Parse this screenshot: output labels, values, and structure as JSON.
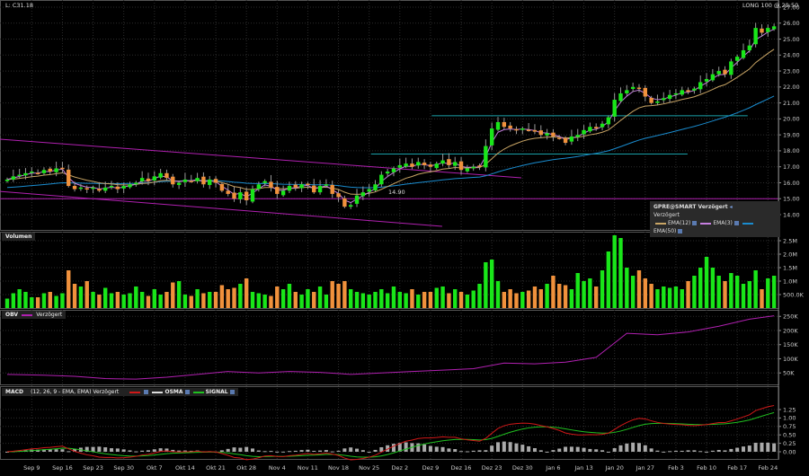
{
  "header": {
    "last_label": "L: C31.18",
    "session_label": "LONG 100 @ 29:50"
  },
  "price_legend": {
    "title": "GPRE@SMART Verzögert",
    "subtitle": "Verzögert",
    "ema12": "EMA(12)",
    "ema3": "EMA(3)",
    "ema50": "EMA(50)"
  },
  "volume_panel": {
    "title": "Volumen"
  },
  "obv_panel": {
    "title": "OBV",
    "delay": "Verzögert"
  },
  "macd_panel": {
    "title": "MACD",
    "params": "(12, 26, 9 - EMA, EMA) Verzögert",
    "osma": "OSMA",
    "signal": "SIGNAL"
  },
  "colors": {
    "up": "#19e619",
    "down": "#f0913c",
    "ema3": "#c77fe0",
    "ema12": "#c9a565",
    "ema50": "#1a8ccf",
    "trend": "#b020b0",
    "level": "#1aa0a8",
    "macd": "#d01818",
    "signal": "#20c020",
    "obv": "#b020b0"
  },
  "chart_data": {
    "type": "candlestick",
    "price_axis": {
      "ticks": [
        "27.00",
        "26.00",
        "25.00",
        "24.00",
        "23.00",
        "22.00",
        "21.00",
        "20.00",
        "19.00",
        "18.00",
        "17.00",
        "16.00",
        "15.00",
        "14.00"
      ],
      "range": [
        13.7,
        27.2
      ]
    },
    "volume_axis": {
      "ticks": [
        "2.5M",
        "2.0M",
        "1.5M",
        "1.0M",
        "500.0K"
      ]
    },
    "obv_axis": {
      "ticks": [
        "250K",
        "200K",
        "150K",
        "100K",
        "50K"
      ]
    },
    "macd_axis": {
      "ticks": [
        "1.25",
        "1.00",
        "0.75",
        "0.50",
        "0.25",
        "0.00"
      ]
    },
    "x_labels": [
      {
        "label": "Sep 9",
        "i": 4
      },
      {
        "label": "Sep 16",
        "i": 9
      },
      {
        "label": "Sep 23",
        "i": 14
      },
      {
        "label": "Sep 30",
        "i": 19
      },
      {
        "label": "Okt 7",
        "i": 24
      },
      {
        "label": "Okt 14",
        "i": 29
      },
      {
        "label": "Okt 21",
        "i": 34
      },
      {
        "label": "Okt 28",
        "i": 39
      },
      {
        "label": "Nov 4",
        "i": 44
      },
      {
        "label": "Nov 11",
        "i": 49
      },
      {
        "label": "Nov 18",
        "i": 54
      },
      {
        "label": "Nov 25",
        "i": 59
      },
      {
        "label": "Dez 2",
        "i": 64
      },
      {
        "label": "Dez 9",
        "i": 69
      },
      {
        "label": "Dez 16",
        "i": 74
      },
      {
        "label": "Dez 23",
        "i": 79
      },
      {
        "label": "Dez 30",
        "i": 84
      },
      {
        "label": "Jan 6",
        "i": 89
      },
      {
        "label": "Jan 13",
        "i": 94
      },
      {
        "label": "Jan 20",
        "i": 99
      },
      {
        "label": "Jan 27",
        "i": 104
      },
      {
        "label": "Feb 3",
        "i": 109
      },
      {
        "label": "Feb 10",
        "i": 114
      },
      {
        "label": "Feb 17",
        "i": 119
      },
      {
        "label": "Feb 24",
        "i": 124
      }
    ],
    "close": [
      16.2,
      16.4,
      16.5,
      16.6,
      16.7,
      16.6,
      16.8,
      16.7,
      16.9,
      16.9,
      15.8,
      15.6,
      15.7,
      15.6,
      15.7,
      15.5,
      15.7,
      15.8,
      15.6,
      15.8,
      15.9,
      16.0,
      16.3,
      16.1,
      16.4,
      16.6,
      16.3,
      15.9,
      16.0,
      16.2,
      16.1,
      16.3,
      15.9,
      16.2,
      16.0,
      15.5,
      15.3,
      15.0,
      15.4,
      14.9,
      15.6,
      15.9,
      16.1,
      15.7,
      15.3,
      15.5,
      15.8,
      15.7,
      15.9,
      15.9,
      15.4,
      15.8,
      15.9,
      15.3,
      15.1,
      14.5,
      14.6,
      15.2,
      15.4,
      15.6,
      15.9,
      16.5,
      16.7,
      16.9,
      17.1,
      17.2,
      17.0,
      17.3,
      17.1,
      17.0,
      17.2,
      17.4,
      17.1,
      17.3,
      16.8,
      16.9,
      17.0,
      17.0,
      18.3,
      19.4,
      19.8,
      19.5,
      19.4,
      19.3,
      19.4,
      19.3,
      19.2,
      19.0,
      19.1,
      18.9,
      18.8,
      18.5,
      18.9,
      19.0,
      19.3,
      19.5,
      19.4,
      19.7,
      20.1,
      21.2,
      21.6,
      21.8,
      22.0,
      21.9,
      21.4,
      21.0,
      21.1,
      21.3,
      21.5,
      21.6,
      21.8,
      21.7,
      21.9,
      22.3,
      22.5,
      22.8,
      23.0,
      22.8,
      23.6,
      23.9,
      24.3,
      24.6,
      25.7,
      25.4,
      25.7,
      25.8
    ],
    "volume_millions": [
      0.35,
      0.55,
      0.7,
      0.6,
      0.4,
      0.4,
      0.55,
      0.6,
      0.45,
      0.55,
      1.4,
      0.9,
      0.8,
      1.0,
      0.6,
      0.5,
      0.75,
      0.55,
      0.6,
      0.5,
      0.55,
      0.8,
      0.6,
      0.45,
      0.7,
      0.5,
      0.6,
      0.95,
      1.0,
      0.5,
      0.45,
      0.7,
      0.55,
      0.6,
      0.6,
      0.85,
      0.7,
      0.75,
      0.9,
      1.1,
      0.6,
      0.55,
      0.5,
      0.45,
      0.8,
      0.7,
      0.9,
      0.6,
      0.5,
      0.7,
      0.6,
      0.8,
      0.5,
      1.0,
      0.9,
      1.0,
      0.7,
      0.6,
      0.55,
      0.5,
      0.6,
      0.7,
      0.55,
      0.8,
      0.6,
      0.55,
      0.7,
      0.5,
      0.6,
      0.6,
      0.75,
      0.8,
      0.55,
      0.7,
      0.6,
      0.5,
      0.65,
      0.9,
      1.7,
      1.8,
      1.0,
      0.6,
      0.7,
      0.55,
      0.6,
      0.65,
      0.8,
      0.7,
      0.9,
      1.2,
      0.9,
      0.85,
      0.7,
      1.3,
      1.0,
      1.1,
      0.8,
      1.4,
      2.1,
      2.7,
      2.6,
      1.5,
      1.2,
      1.4,
      1.1,
      0.9,
      0.7,
      0.8,
      0.75,
      0.8,
      0.7,
      1.0,
      1.2,
      1.5,
      1.9,
      1.5,
      1.2,
      1.0,
      1.3,
      1.2,
      0.9,
      1.0,
      1.4,
      0.7,
      1.1,
      1.2
    ],
    "obv_weekly_k": [
      45,
      42,
      38,
      30,
      28,
      35,
      45,
      55,
      50,
      55,
      52,
      45,
      50,
      55,
      60,
      65,
      85,
      82,
      88,
      105,
      190,
      185,
      195,
      215,
      240,
      252
    ],
    "trendlines": [
      {
        "name": "upper-channel",
        "i1": -1.2,
        "p1": 18.73,
        "i2": 83.8,
        "p2": 16.31
      },
      {
        "name": "lower-channel",
        "i1": -1.2,
        "p1": 15.46,
        "i2": 70.9,
        "p2": 13.27
      },
      {
        "name": "support-15",
        "i1": -2,
        "p1": 15.0,
        "i2": 126,
        "p2": 15.0
      },
      {
        "name": "level-17-8",
        "i1": 59.3,
        "p1": 17.8,
        "i2": 110.9,
        "p2": 17.8
      },
      {
        "name": "level-20-2",
        "i1": 69.2,
        "p1": 20.2,
        "i2": 120.7,
        "p2": 20.2
      }
    ],
    "annotation": {
      "text": "14.90"
    }
  }
}
